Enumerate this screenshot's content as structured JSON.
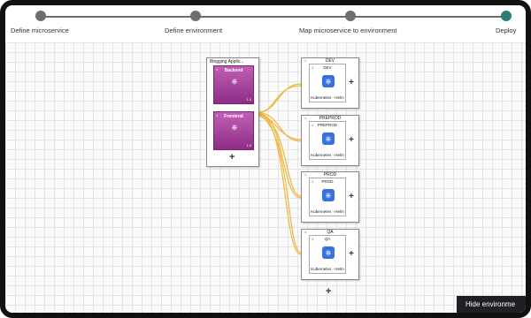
{
  "stepper": {
    "steps": [
      {
        "label": "Define microservice",
        "active": false
      },
      {
        "label": "Define environment",
        "active": false
      },
      {
        "label": "Map microservice to environment",
        "active": false
      },
      {
        "label": "Deploy",
        "active": true
      }
    ]
  },
  "application": {
    "title": "Blogging Applic...",
    "services": [
      {
        "name": "Backend",
        "number": "1",
        "footer": "1.0"
      },
      {
        "name": "Frontend",
        "number": "1",
        "footer": "1.0"
      }
    ],
    "add_symbol": "+"
  },
  "environments": [
    {
      "title": "DEV",
      "number": "1",
      "inner_title": "DEV",
      "inner_number": "1",
      "caption": "Kubernetes - Helm",
      "add_symbol": "+"
    },
    {
      "title": "PREPROD",
      "number": "1",
      "inner_title": "PREPROD",
      "inner_number": "1",
      "caption": "Kubernetes - Helm",
      "add_symbol": "+"
    },
    {
      "title": "PROD",
      "number": "1",
      "inner_title": "PROD",
      "inner_number": "1",
      "caption": "Kubernetes - Helm",
      "add_symbol": "+"
    },
    {
      "title": "QA",
      "number": "1",
      "inner_title": "QA",
      "inner_number": "1",
      "caption": "Kubernetes - Helm",
      "add_symbol": "+"
    }
  ],
  "env_add_symbol": "+",
  "hide_button": {
    "label": "Hide environme"
  },
  "colors": {
    "connector": "#f0b640",
    "service_bg": "#a73f9c",
    "step_active": "#2e7d73",
    "k8s": "#3970e4"
  }
}
